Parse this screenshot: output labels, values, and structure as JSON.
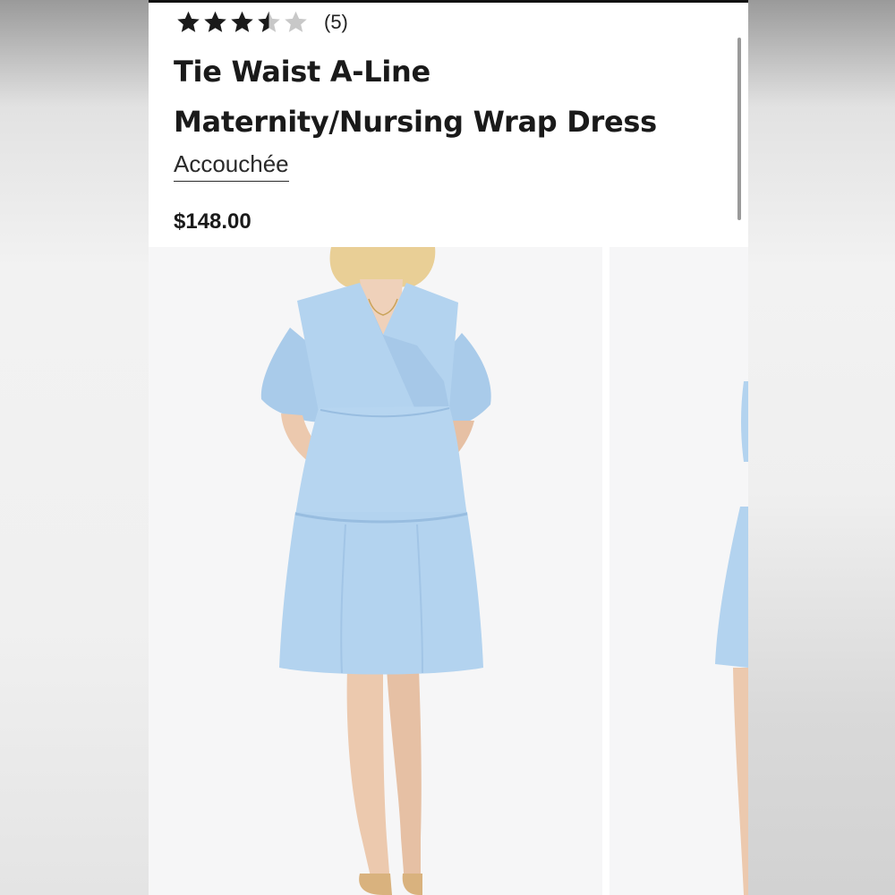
{
  "product": {
    "rating": {
      "value": 3.5,
      "max": 5,
      "count_label": "(5)"
    },
    "title_line1": "Tie Waist A-Line",
    "title_line2": "Maternity/Nursing Wrap Dress",
    "brand": "Accouchée",
    "price": "$148.00"
  },
  "gallery": {
    "images": [
      {
        "label": "Woman wearing light blue tiered wrap dress, front view"
      },
      {
        "label": "Woman wearing light blue tiered wrap dress, side view"
      }
    ]
  },
  "colors": {
    "star_filled": "#1a1a1a",
    "star_empty": "#c8c8c8",
    "dress": "#b3d3ef",
    "photo_bg": "#f6f6f7"
  }
}
